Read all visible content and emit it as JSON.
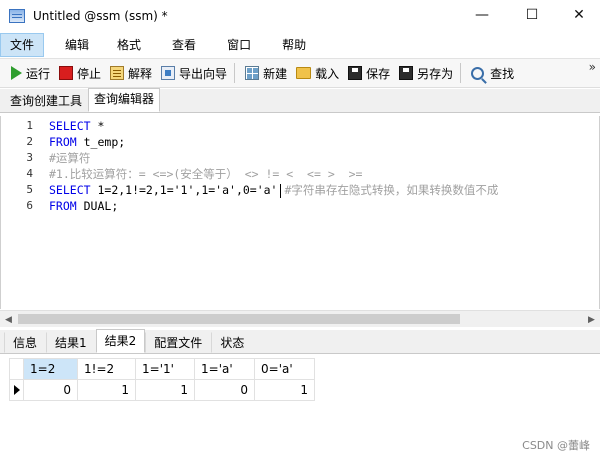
{
  "window": {
    "title": "Untitled @ssm (ssm) *",
    "minimize_glyph": "—",
    "maximize_glyph": "☐",
    "close_glyph": "✕"
  },
  "menu": {
    "items": [
      "文件",
      "编辑",
      "格式",
      "查看",
      "窗口",
      "帮助"
    ]
  },
  "toolbar": {
    "run": "运行",
    "stop": "停止",
    "explain": "解释",
    "export_wizard": "导出向导",
    "new": "新建",
    "load": "载入",
    "save": "保存",
    "save_as": "另存为",
    "find": "查找",
    "more": "»"
  },
  "doc_tabs": [
    "查询创建工具",
    "查询编辑器"
  ],
  "editor": {
    "line_numbers": [
      "1",
      "2",
      "3",
      "4",
      "5",
      "6"
    ],
    "lines": {
      "l1_kw": "SELECT",
      "l1_rest": " *",
      "l2_kw": "FROM",
      "l2_rest": " t_emp;",
      "l3_comment": "#运算符",
      "l4_comment": "#1.比较运算符：= <=>(安全等于） <> != <  <= >  >=",
      "l5_kw": "SELECT",
      "l5_rest": " 1=2,1!=2,1='1',1='a',0='a'",
      "l5_comment": "#字符串存在隐式转换，如果转换数值不成",
      "l6_kw": "FROM",
      "l6_rest": " DUAL;"
    }
  },
  "result_tabs": [
    "信息",
    "结果1",
    "结果2",
    "配置文件",
    "状态"
  ],
  "result_grid": {
    "columns": [
      "1=2",
      "1!=2",
      "1='1'",
      "1='a'",
      "0='a'"
    ],
    "rows": [
      [
        "0",
        "1",
        "1",
        "0",
        "1"
      ]
    ]
  },
  "watermark": "CSDN @蕾峰"
}
